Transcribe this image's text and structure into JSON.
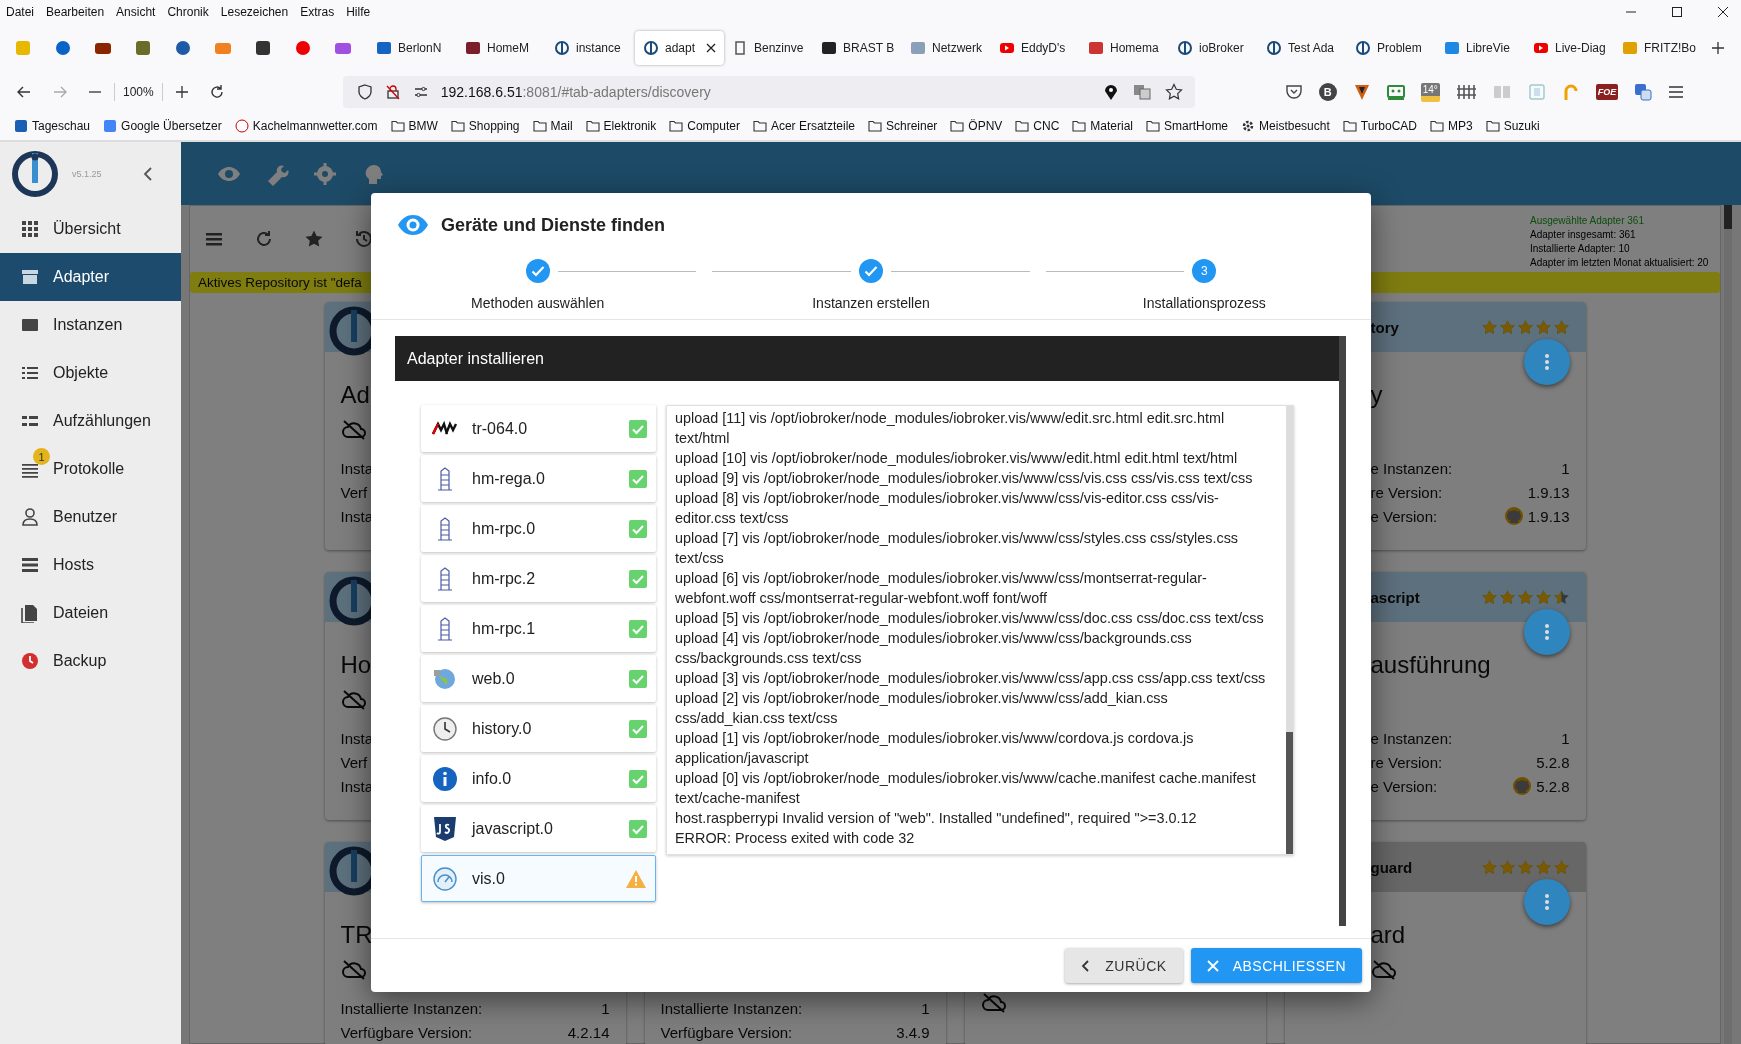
{
  "menu_bar": [
    "Datei",
    "Bearbeiten",
    "Ansicht",
    "Chronik",
    "Lesezeichen",
    "Extras",
    "Hilfe"
  ],
  "tabs": [
    {
      "title": "BerlonN",
      "selected": false
    },
    {
      "title": "HomeM",
      "selected": false
    },
    {
      "title": "instance",
      "selected": false
    },
    {
      "title": "adapt",
      "selected": true
    },
    {
      "title": "Benzinve",
      "selected": false
    },
    {
      "title": "BRAST B",
      "selected": false
    },
    {
      "title": "Netzwerk",
      "selected": false
    },
    {
      "title": "EddyD's",
      "selected": false
    },
    {
      "title": "Homema",
      "selected": false
    },
    {
      "title": "ioBroker",
      "selected": false
    },
    {
      "title": "Test Ada",
      "selected": false
    },
    {
      "title": "Problem",
      "selected": false
    },
    {
      "title": "LibreVie",
      "selected": false
    },
    {
      "title": "Live-Diag",
      "selected": false
    },
    {
      "title": "FRITZ!Bo",
      "selected": false
    }
  ],
  "navigation": {
    "zoom": "100%",
    "url_host": "192.168.6.51",
    "url_path": ":8081/#tab-adapters/discovery",
    "badge_letter": "B",
    "weather": "14°",
    "game_label": "FOE"
  },
  "bookmarks": [
    {
      "label": "Tageschau",
      "kind": "site"
    },
    {
      "label": "Google Übersetzer",
      "kind": "site"
    },
    {
      "label": "Kachelmannwetter.com",
      "kind": "site"
    },
    {
      "label": "BMW",
      "kind": "folder"
    },
    {
      "label": "Shopping",
      "kind": "folder"
    },
    {
      "label": "Mail",
      "kind": "folder"
    },
    {
      "label": "Elektronik",
      "kind": "folder"
    },
    {
      "label": "Computer",
      "kind": "folder"
    },
    {
      "label": "Acer Ersatzteile",
      "kind": "folder"
    },
    {
      "label": "Schreiner",
      "kind": "folder"
    },
    {
      "label": "ÖPNV",
      "kind": "folder"
    },
    {
      "label": "CNC",
      "kind": "folder"
    },
    {
      "label": "Material",
      "kind": "folder"
    },
    {
      "label": "SmartHome",
      "kind": "folder"
    },
    {
      "label": "Meistbesucht",
      "kind": "smart"
    },
    {
      "label": "TurboCAD",
      "kind": "folder"
    },
    {
      "label": "MP3",
      "kind": "folder"
    },
    {
      "label": "Suzuki",
      "kind": "folder"
    }
  ],
  "sidebar": {
    "version": "v5.1.25",
    "items": [
      {
        "label": "Übersicht",
        "selected": false
      },
      {
        "label": "Adapter",
        "selected": true
      },
      {
        "label": "Instanzen",
        "selected": false
      },
      {
        "label": "Objekte",
        "selected": false
      },
      {
        "label": "Aufzählungen",
        "selected": false
      },
      {
        "label": "Protokolle",
        "selected": false,
        "badge": "1"
      },
      {
        "label": "Benutzer",
        "selected": false
      },
      {
        "label": "Hosts",
        "selected": false
      },
      {
        "label": "Dateien",
        "selected": false
      },
      {
        "label": "Backup",
        "selected": false
      }
    ]
  },
  "stats": {
    "selected": "Ausgewählte Adapter 361",
    "lines": [
      "Adapter insgesamt: 361",
      "Installierte Adapter: 10",
      "Adapter im letzten Monat aktualisiert: 20"
    ]
  },
  "repository_notice": "Aktives Repository ist \"defa",
  "card_columns": [
    [
      {
        "logo": true,
        "installed": true,
        "title": "Ad",
        "cloud": true,
        "rows": [
          {
            "label": "Insta"
          },
          {
            "label": "Verf"
          },
          {
            "label": "Insta"
          }
        ]
      },
      {
        "logo": true,
        "installed": true,
        "title": "Ho",
        "cloud": true,
        "rows": [
          {
            "label": "Insta"
          },
          {
            "label": "Verf"
          },
          {
            "label": "Insta"
          }
        ]
      },
      {
        "logo": true,
        "installed": true,
        "title": "TR",
        "cloud": true,
        "rows": [
          {
            "label": "Installierte Instanzen:",
            "value": "1"
          },
          {
            "label": "Verfügbare Version:",
            "value": "4.2.14"
          }
        ]
      }
    ],
    [
      {
        "rows": [
          {
            "label": "Installierte Instanzen:",
            "value": "1"
          },
          {
            "label": "Verfügbare Version:",
            "value": "3.4.9"
          }
        ]
      }
    ],
    [
      {
        "cloud": true
      }
    ],
    [
      {
        "header_title": "tory",
        "stars": 5,
        "installed": true,
        "menu_button": true,
        "title": "y",
        "rows": [
          {
            "label": "e Instanzen:",
            "value": "1"
          },
          {
            "label": "re Version:",
            "value": "1.9.13"
          },
          {
            "label": "e Version:",
            "value": "1.9.13",
            "github": true
          }
        ]
      },
      {
        "header_title": "ascript",
        "stars": 4.5,
        "installed": true,
        "menu_button": true,
        "title": "ausführung",
        "rows": [
          {
            "label": "e Instanzen:",
            "value": "1"
          },
          {
            "label": "re Version:",
            "value": "5.2.8"
          },
          {
            "label": "e Version:",
            "value": "5.2.8",
            "github": true
          }
        ]
      },
      {
        "header_title": "guard",
        "stars": 5,
        "installed": false,
        "menu_button": true,
        "title": "ard",
        "cloud": true
      }
    ]
  ],
  "dialog": {
    "title": "Geräte und Dienste finden",
    "steps": [
      {
        "label": "Methoden auswählen",
        "completed": true
      },
      {
        "label": "Instanzen erstellen",
        "completed": true
      },
      {
        "label": "Installationsprozess",
        "completed": false,
        "number": "3"
      }
    ],
    "section_title": "Adapter installieren",
    "adapters": [
      {
        "name": "tr-064.0",
        "failed": false,
        "selected": false
      },
      {
        "name": "hm-rega.0",
        "failed": false,
        "selected": false
      },
      {
        "name": "hm-rpc.0",
        "failed": false,
        "selected": false
      },
      {
        "name": "hm-rpc.2",
        "failed": false,
        "selected": false
      },
      {
        "name": "hm-rpc.1",
        "failed": false,
        "selected": false
      },
      {
        "name": "web.0",
        "failed": false,
        "selected": false
      },
      {
        "name": "history.0",
        "failed": false,
        "selected": false
      },
      {
        "name": "info.0",
        "failed": false,
        "selected": false
      },
      {
        "name": "javascript.0",
        "failed": false,
        "selected": false
      },
      {
        "name": "vis.0",
        "failed": true,
        "selected": true
      }
    ],
    "log": [
      "upload [11] vis /opt/iobroker/node_modules/iobroker.vis/www/edit.src.html edit.src.html text/html",
      "upload [10] vis /opt/iobroker/node_modules/iobroker.vis/www/edit.html edit.html text/html",
      "upload [9] vis /opt/iobroker/node_modules/iobroker.vis/www/css/vis.css css/vis.css text/css",
      "upload [8] vis /opt/iobroker/node_modules/iobroker.vis/www/css/vis-editor.css css/vis-editor.css text/css",
      "upload [7] vis /opt/iobroker/node_modules/iobroker.vis/www/css/styles.css css/styles.css text/css",
      "upload [6] vis /opt/iobroker/node_modules/iobroker.vis/www/css/montserrat-regular-webfont.woff css/montserrat-regular-webfont.woff font/woff",
      "upload [5] vis /opt/iobroker/node_modules/iobroker.vis/www/css/doc.css css/doc.css text/css",
      "upload [4] vis /opt/iobroker/node_modules/iobroker.vis/www/css/backgrounds.css css/backgrounds.css text/css",
      "upload [3] vis /opt/iobroker/node_modules/iobroker.vis/www/css/app.css css/app.css text/css",
      "upload [2] vis /opt/iobroker/node_modules/iobroker.vis/www/css/add_kian.css css/add_kian.css text/css",
      "upload [1] vis /opt/iobroker/node_modules/iobroker.vis/www/cordova.js cordova.js application/javascript",
      "upload [0] vis /opt/iobroker/node_modules/iobroker.vis/www/cache.manifest cache.manifest text/cache-manifest",
      "host.raspberrypi Invalid version of \"web\". Installed \"undefined\", required \">=3.0.12",
      "ERROR: Process exited with code 32"
    ],
    "buttons": [
      {
        "label": "ZURÜCK",
        "kind": "back"
      },
      {
        "label": "ABSCHLIESSEN",
        "kind": "finish"
      }
    ]
  }
}
